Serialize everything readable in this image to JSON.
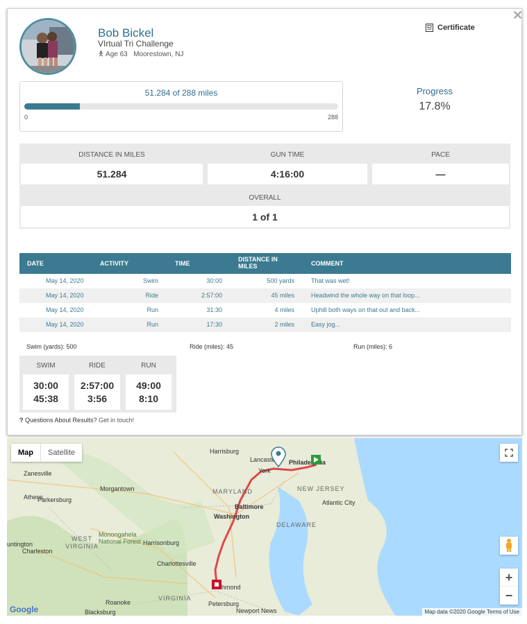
{
  "profile": {
    "name": "Bob Bickel",
    "event": "VIrtual Tri Challenge",
    "age": "Age 63",
    "location": "Moorestown, NJ",
    "certificate_label": "Certificate",
    "close_glyph": "✕"
  },
  "progress": {
    "label": "51.284 of 288 miles",
    "fraction": 0.178,
    "min": "0",
    "max": "288",
    "title": "Progress",
    "percent": "17.8%"
  },
  "stats": {
    "distance_label": "DISTANCE IN MILES",
    "distance_value": "51.284",
    "guntime_label": "GUN TIME",
    "guntime_value": "4:16:00",
    "pace_label": "PACE",
    "pace_value": "—",
    "overall_label": "OVERALL",
    "overall_value": "1 of 1"
  },
  "activities": {
    "headers": [
      "DATE",
      "ACTIVITY",
      "TIME",
      "DISTANCE IN MILES",
      "COMMENT"
    ],
    "rows": [
      {
        "date": "May 14, 2020",
        "activity": "Swim",
        "time": "30:00",
        "distance": "500 yards",
        "comment": "That was wet!"
      },
      {
        "date": "May 14, 2020",
        "activity": "Ride",
        "time": "2:57:00",
        "distance": "45 miles",
        "comment": "Headwind the whole way on that loop..."
      },
      {
        "date": "May 14, 2020",
        "activity": "Run",
        "time": "31:30",
        "distance": "4 miles",
        "comment": "Uphill both ways on that out and back..."
      },
      {
        "date": "May 14, 2020",
        "activity": "Run",
        "time": "17:30",
        "distance": "2 miles",
        "comment": "Easy jog..."
      }
    ]
  },
  "totals": {
    "swim": "Swim (yards): 500",
    "ride": "Ride (miles): 45",
    "run": "Run (miles): 6"
  },
  "splits": {
    "swim_label": "SWIM",
    "swim_time": "30:00",
    "swim_pace": "45:38",
    "ride_label": "RIDE",
    "ride_time": "2:57:00",
    "ride_pace": "3:56",
    "run_label": "RUN",
    "run_time": "49:00",
    "run_pace": "8:10"
  },
  "footer": {
    "question": "Questions About Results?",
    "link": "Get in touch!"
  },
  "map": {
    "map_btn": "Map",
    "satellite_btn": "Satellite",
    "zoom_in": "+",
    "zoom_out": "−",
    "attribution": "Map data ©2020 Google   Terms of Use",
    "google": "Google",
    "cities": {
      "harrisburg": "Harrisburg",
      "lancaster": "Lancaster",
      "philadelphia": "Philadelphia",
      "york": "York",
      "baltimore": "Baltimore",
      "washington": "Washington",
      "morgantown": "Morgantown",
      "zanesville": "Zanesville",
      "parkersburg": "Parkersburg",
      "charleston": "Charleston",
      "harrisonburg": "Harrisonburg",
      "charlottesville": "Charlottesville",
      "richmond": "Richmond",
      "roanoke": "Roanoke",
      "blacksburg": "Blacksburg",
      "petersburg": "Petersburg",
      "newport": "Newport News",
      "atlantic": "Atlantic City",
      "athens": "Athens",
      "huntington": "untington",
      "monongahela": "Monongahela National Forest"
    },
    "states": {
      "maryland": "MARYLAND",
      "newjersey": "NEW JERSEY",
      "delaware": "DELAWARE",
      "westvirginia": "WEST VIRGINIA",
      "virginia": "VIRGINIA"
    },
    "colors": {
      "land": "#e8ecd8",
      "water": "#aadaff",
      "route": "#e0474c",
      "forest": "#c8e0b4"
    }
  }
}
